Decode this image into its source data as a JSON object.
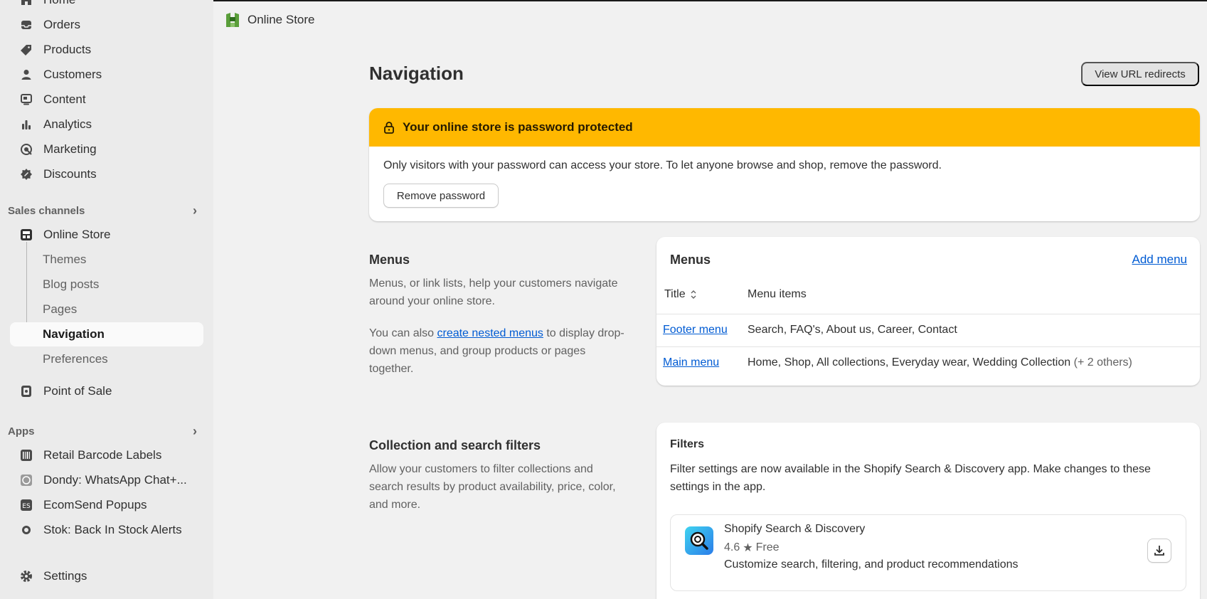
{
  "sidebar": {
    "top_items": [
      {
        "label": "Home",
        "icon": "home-icon"
      },
      {
        "label": "Orders",
        "icon": "inbox-icon"
      },
      {
        "label": "Products",
        "icon": "tag-icon"
      },
      {
        "label": "Customers",
        "icon": "person-icon"
      },
      {
        "label": "Content",
        "icon": "content-icon"
      },
      {
        "label": "Analytics",
        "icon": "bar-chart-icon"
      },
      {
        "label": "Marketing",
        "icon": "target-icon"
      },
      {
        "label": "Discounts",
        "icon": "discount-icon"
      }
    ],
    "sales_channels": {
      "heading": "Sales channels",
      "online_store": "Online Store",
      "sub_items": [
        "Themes",
        "Blog posts",
        "Pages",
        "Navigation",
        "Preferences"
      ],
      "active_sub_item": "Navigation",
      "point_of_sale": "Point of Sale"
    },
    "apps": {
      "heading": "Apps",
      "items": [
        "Retail Barcode Labels",
        "Dondy: WhatsApp Chat+...",
        "EcomSend Popups",
        "Stok: Back In Stock Alerts"
      ]
    },
    "settings": "Settings"
  },
  "header": {
    "store_label": "Online Store"
  },
  "page": {
    "title": "Navigation",
    "redirects_button": "View URL redirects"
  },
  "banner": {
    "title": "Your online store is password protected",
    "text": "Only visitors with your password can access your store. To let anyone browse and shop, remove the password.",
    "button": "Remove password",
    "color": "#ffb800"
  },
  "menus_section": {
    "title": "Menus",
    "desc1": "Menus, or link lists, help your customers navigate around your online store.",
    "desc2_pre": "You can also ",
    "desc2_link": "create nested menus",
    "desc2_post": " to display drop-down menus, and group products or pages together."
  },
  "menus_card": {
    "title": "Menus",
    "add_label": "Add menu",
    "col_title": "Title",
    "col_items": "Menu items",
    "rows": [
      {
        "title": "Footer menu",
        "items": "Search, FAQ's, About us, Career, Contact",
        "others": ""
      },
      {
        "title": "Main menu",
        "items": "Home, Shop, All collections, Everyday wear, Wedding Collection",
        "others": "(+ 2 others)"
      }
    ]
  },
  "filters_section": {
    "title": "Collection and search filters",
    "desc": "Allow your customers to filter collections and search results by product availability, price, color, and more."
  },
  "filters_card": {
    "title": "Filters",
    "text": "Filter settings are now available in the Shopify Search & Discovery app. Make changes to these settings in the app.",
    "app": {
      "name": "Shopify Search & Discovery",
      "rating": "4.6",
      "price": "Free",
      "desc": "Customize search, filtering, and product recommendations"
    }
  },
  "colors": {
    "link": "#005bd3",
    "sidebar_bg": "#ebebeb",
    "page_bg": "#f1f1f1"
  }
}
